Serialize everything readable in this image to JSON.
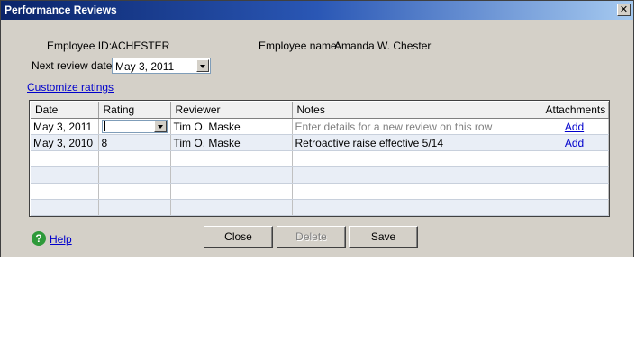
{
  "window": {
    "title": "Performance Reviews",
    "close_glyph": "✕"
  },
  "employee": {
    "id_label": "Employee ID:",
    "id_value": "ACHESTER",
    "name_label": "Employee name:",
    "name_value": "Amanda W. Chester"
  },
  "next_review": {
    "label": "Next review date:",
    "value": "May 3, 2011"
  },
  "customize_link": "Customize ratings",
  "grid": {
    "columns": [
      "Date",
      "Rating",
      "Reviewer",
      "Notes",
      "Attachments"
    ],
    "rows": [
      {
        "date": "May 3, 2011",
        "rating": "",
        "reviewer": "Tim O. Maske",
        "notes": "Enter details for a new review on this row",
        "attachments": "Add"
      },
      {
        "date": "May 3, 2010",
        "rating": "8",
        "reviewer": "Tim O. Maske",
        "notes": "Retroactive raise effective 5/14",
        "attachments": "Add"
      }
    ]
  },
  "buttons": {
    "close": "Close",
    "delete": "Delete",
    "save": "Save"
  },
  "help": {
    "icon": "?",
    "label": "Help"
  }
}
